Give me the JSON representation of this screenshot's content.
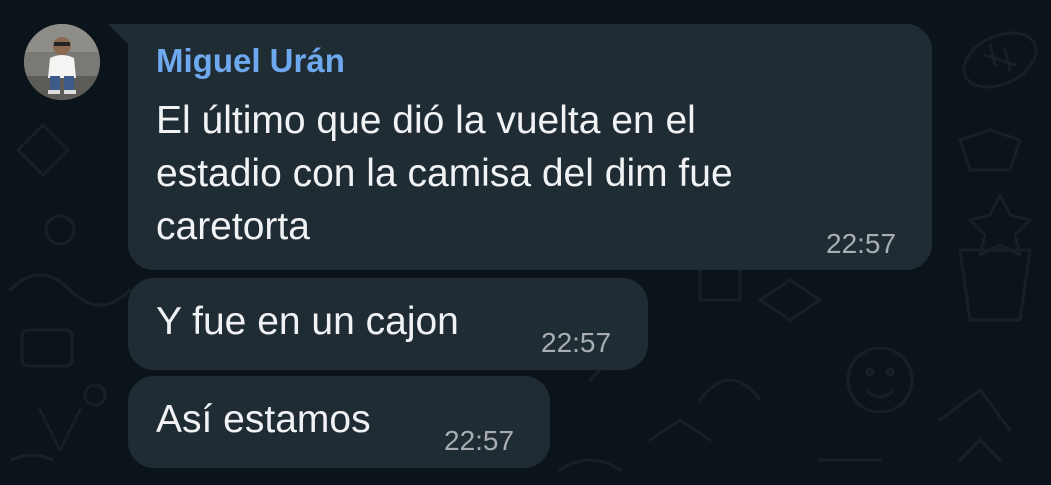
{
  "chat": {
    "sender_name": "Miguel Urán",
    "messages": [
      {
        "text": "El último que dió la vuelta en el\nestadio con la camisa del dim fue\ncaretorta",
        "time": "22:57"
      },
      {
        "text": "Y fue en un cajon",
        "time": "22:57"
      },
      {
        "text": "Así estamos",
        "time": "22:57"
      }
    ]
  },
  "colors": {
    "background": "#0b141a",
    "bubble": "#202c33",
    "sender_name": "#6ea8ee",
    "message_text": "#f0f2f4",
    "timestamp": "#a7adb2"
  },
  "icons": {
    "avatar": "contact-photo"
  }
}
